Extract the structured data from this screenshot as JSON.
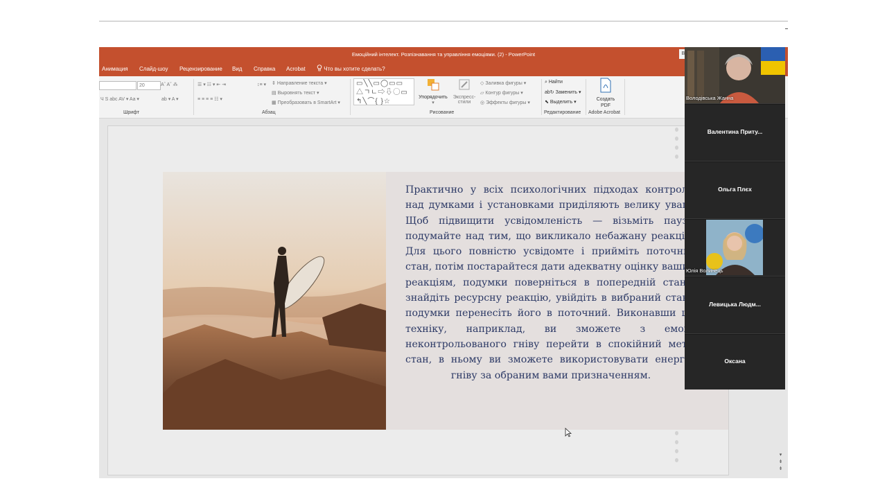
{
  "window": {
    "title": "Емоційний інтелект. Розпізнавання та управління емоціями. (2)  -  PowerPoint",
    "corner_button": "В"
  },
  "menu": {
    "items": [
      "Анимация",
      "Слайд-шоу",
      "Рецензирование",
      "Вид",
      "Справка",
      "Acrobat"
    ],
    "search_placeholder": "Что вы хотите сделать?"
  },
  "ribbon": {
    "font": {
      "size_value": "20",
      "row1": "Aˆ  Aˇ   ⁂",
      "row2": "Ч  S  abc  AV ▾  Aa ▾",
      "row2b": "ab ▾  A ▾",
      "label": "Шрифт"
    },
    "paragraph": {
      "text_direction": "Направление текста",
      "align_text": "Выровнять текст",
      "smartart": "Преобразовать в SmartArt",
      "label": "Абзац"
    },
    "drawing": {
      "shapes_row1": "▭╲╲▭◯▭▭",
      "shapes_row2": "△ㄱㄴ⇨⇩◯▭",
      "shapes_row3": "↰╲⌒{ }☆",
      "arrange": "Упорядочить",
      "quick_styles_1": "Экспресс-",
      "quick_styles_2": "стили",
      "fill": "Заливка фигуры",
      "outline": "Контур фигуры",
      "effects": "Эффекты фигуры",
      "label": "Рисование"
    },
    "editing": {
      "find": "Найти",
      "replace": "Заменить",
      "select": "Выделить",
      "label": "Редактирование"
    },
    "acrobat": {
      "create_pdf_1": "Создать",
      "create_pdf_2": "PDF",
      "label": "Adobe Acrobat"
    }
  },
  "slide": {
    "text": "Практично у всіх психологічних підходах контролю над думками і установками приділяють велику увагу. Щоб підвищити усвідомленість — візьміть паузу, подумайте над тим, що викликало небажану реакцію. Для цього повністю усвідомте і прийміть поточний стан, потім постарайтеся дати адекватну оцінку вашим реакціям, подумки поверніться в попередній стан і знайдіть ресурсну реакцію, увійдіть в вибраний стан і подумки перенесіть його в поточний. Виконавши цю техніку, наприклад, ви зможете з емоції неконтрольованого гніву перейти в спокійний мета-стан, в ньому ви зможете використовувати енергію гніву за обраним вами призначенням."
  },
  "participants": [
    {
      "name": "Володівська Жанна",
      "video": true
    },
    {
      "name": "Валентина  Приту...",
      "video": false
    },
    {
      "name": "Ольга Плєх",
      "video": false
    },
    {
      "name": "Юлія Волинець",
      "video": true
    },
    {
      "name": "Левицька  Людм...",
      "video": false
    },
    {
      "name": "Оксана",
      "video": false
    }
  ]
}
